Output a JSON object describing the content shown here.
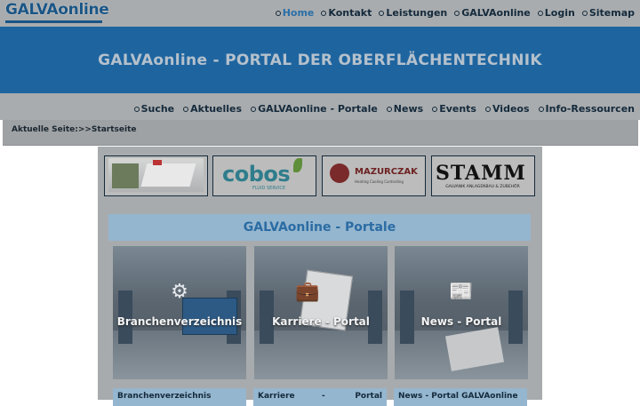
{
  "logo": {
    "text": "GALVAonline"
  },
  "top_nav": [
    {
      "label": "Home",
      "active": true
    },
    {
      "label": "Kontakt"
    },
    {
      "label": "Leistungen"
    },
    {
      "label": "GALVAonline"
    },
    {
      "label": "Login"
    },
    {
      "label": "Sitemap"
    }
  ],
  "banner": {
    "title": "GALVAonline - PORTAL DER OBERFLÄCHENTECHNIK"
  },
  "sub_nav": [
    {
      "label": "Suche"
    },
    {
      "label": "Aktuelles"
    },
    {
      "label": "GALVAonline - Portale"
    },
    {
      "label": "News"
    },
    {
      "label": "Events"
    },
    {
      "label": "Videos"
    },
    {
      "label": "Info-Ressourcen"
    }
  ],
  "breadcrumb": {
    "text": "Aktuelle Seite:>>Startseite"
  },
  "sponsors": {
    "cobos": {
      "name": "cobos",
      "tagline": "FLUID SERVICE"
    },
    "mazurczak": {
      "name": "MAZURCZAK",
      "tagline": "Heating Cooling Controlling"
    },
    "stamm": {
      "name": "STAMM",
      "tagline": "GALVANIK ANLAGENBAU & ZUBEHÖR"
    }
  },
  "portals": {
    "heading": "GALVAonline - Portale",
    "cards": [
      {
        "label": "Branchenverzeichnis",
        "icon": "magnifier-gear-icon"
      },
      {
        "label": "Karriere - Portal",
        "icon": "briefcase-icon"
      },
      {
        "label": "News - Portal",
        "icon": "newspaper-megaphone-icon"
      }
    ],
    "captions": [
      {
        "text": "Branchenverzeichnis"
      },
      {
        "part1": "Karriere",
        "part2": "-",
        "part3": "Portal"
      },
      {
        "text": "News - Portal GALVAonline"
      }
    ]
  },
  "colors": {
    "topbar": "#a9acae",
    "banner": "#1e65a0",
    "accent": "#2b6ca3",
    "text_dark": "#142a3c"
  }
}
